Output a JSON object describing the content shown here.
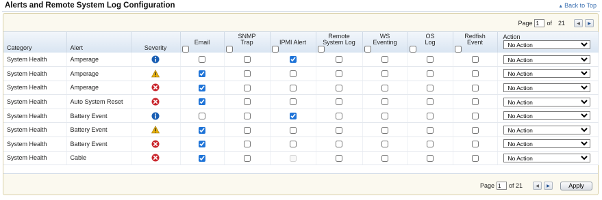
{
  "title": "Alerts and Remote System Log Configuration",
  "back_to_top": "Back to Top",
  "pager_top": {
    "label": "Page",
    "current": "1",
    "of_label": "of",
    "total": "21"
  },
  "pager_bottom": {
    "label": "Page",
    "current": "1",
    "of_label": "of 21",
    "apply": "Apply"
  },
  "columns": {
    "category": "Category",
    "alert": "Alert",
    "severity": "Severity",
    "email": "Email",
    "snmp": "SNMP\nTrap",
    "ipmi": "IPMI Alert",
    "remote": "Remote\nSystem Log",
    "ws": "WS\nEventing",
    "os": "OS\nLog",
    "redfish": "Redfish\nEvent",
    "action": "Action"
  },
  "header_action_value": "No Action",
  "action_options": [
    "No Action"
  ],
  "colors": {
    "info": "#1a5fb4",
    "warning": "#e8b10e",
    "critical": "#c9252c"
  },
  "rows": [
    {
      "category": "System Health",
      "alert": "Amperage",
      "severity": "info",
      "email": false,
      "snmp": false,
      "ipmi": true,
      "ipmi_disabled": false,
      "remote": false,
      "ws": false,
      "os": false,
      "redfish": false,
      "action": "No Action"
    },
    {
      "category": "System Health",
      "alert": "Amperage",
      "severity": "warning",
      "email": true,
      "snmp": false,
      "ipmi": false,
      "ipmi_disabled": false,
      "remote": false,
      "ws": false,
      "os": false,
      "redfish": false,
      "action": "No Action"
    },
    {
      "category": "System Health",
      "alert": "Amperage",
      "severity": "critical",
      "email": true,
      "snmp": false,
      "ipmi": false,
      "ipmi_disabled": false,
      "remote": false,
      "ws": false,
      "os": false,
      "redfish": false,
      "action": "No Action"
    },
    {
      "category": "System Health",
      "alert": "Auto System Reset",
      "severity": "critical",
      "email": true,
      "snmp": false,
      "ipmi": false,
      "ipmi_disabled": false,
      "remote": false,
      "ws": false,
      "os": false,
      "redfish": false,
      "action": "No Action"
    },
    {
      "category": "System Health",
      "alert": "Battery Event",
      "severity": "info",
      "email": false,
      "snmp": false,
      "ipmi": true,
      "ipmi_disabled": false,
      "remote": false,
      "ws": false,
      "os": false,
      "redfish": false,
      "action": "No Action"
    },
    {
      "category": "System Health",
      "alert": "Battery Event",
      "severity": "warning",
      "email": true,
      "snmp": false,
      "ipmi": false,
      "ipmi_disabled": false,
      "remote": false,
      "ws": false,
      "os": false,
      "redfish": false,
      "action": "No Action"
    },
    {
      "category": "System Health",
      "alert": "Battery Event",
      "severity": "critical",
      "email": true,
      "snmp": false,
      "ipmi": false,
      "ipmi_disabled": false,
      "remote": false,
      "ws": false,
      "os": false,
      "redfish": false,
      "action": "No Action"
    },
    {
      "category": "System Health",
      "alert": "Cable",
      "severity": "critical",
      "email": true,
      "snmp": false,
      "ipmi": false,
      "ipmi_disabled": true,
      "remote": false,
      "ws": false,
      "os": false,
      "redfish": false,
      "action": "No Action"
    }
  ]
}
